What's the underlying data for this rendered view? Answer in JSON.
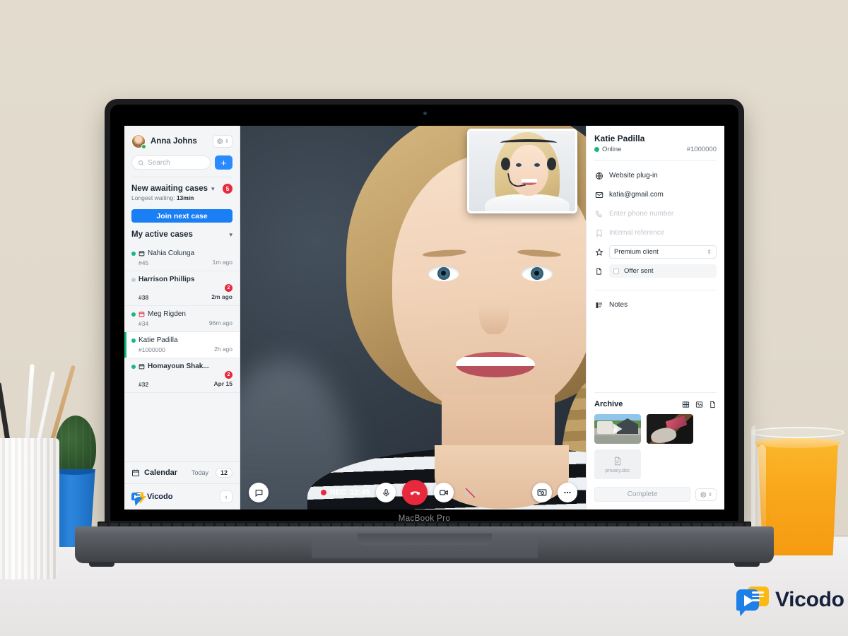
{
  "scene": {
    "device_label": "MacBook Pro",
    "brand": {
      "name": "Vicodo",
      "blue": "#1f7fe8",
      "yellow": "#fdb913",
      "text_color": "#16213c"
    }
  },
  "sidebar": {
    "user": {
      "name": "Anna Johns",
      "status": "online"
    },
    "settings_button_icon": "gear-icon",
    "search": {
      "placeholder": "Search",
      "value": ""
    },
    "add_button_label": "+",
    "awaiting": {
      "title": "New awaiting cases",
      "count": "5",
      "longest_label": "Longest waiting:",
      "longest_value": "13min",
      "join_button": "Join next case"
    },
    "active_section_title": "My active cases",
    "cases": [
      {
        "name": "Nahia Colunga",
        "id": "#45",
        "time": "1m ago",
        "presence": "#13b981",
        "icon": "calendar-icon",
        "unread": "",
        "bold": false,
        "active": false
      },
      {
        "name": "Harrison Phillips",
        "id": "#38",
        "time": "2m ago",
        "presence": "#c7ccd2",
        "icon": "",
        "unread": "2",
        "bold": true,
        "active": false
      },
      {
        "name": "Meg Rigden",
        "id": "#34",
        "time": "96m ago",
        "presence": "#13b981",
        "icon": "calendar-alert-icon",
        "unread": "",
        "bold": false,
        "active": false
      },
      {
        "name": "Katie Padilla",
        "id": "#1000000",
        "time": "2h ago",
        "presence": "#13b981",
        "icon": "",
        "unread": "",
        "bold": false,
        "active": true
      },
      {
        "name": "Homayoun Shak...",
        "id": "#32",
        "time": "Apr 15",
        "presence": "#13b981",
        "icon": "calendar-icon",
        "unread": "2",
        "bold": true,
        "active": false
      }
    ],
    "calendar": {
      "label": "Calendar",
      "today_label": "Today",
      "count": "12",
      "icon": "calendar-icon"
    },
    "footer": {
      "brand": "Vicodo",
      "collapse_icon": "chevron-left-icon"
    }
  },
  "call": {
    "recording_label": "REC",
    "timer": "12:45",
    "controls": [
      {
        "name": "chat-button",
        "icon": "chat-bubble-icon"
      },
      {
        "name": "microphone-button",
        "icon": "microphone-icon"
      },
      {
        "name": "end-call-button",
        "icon": "hangup-icon"
      },
      {
        "name": "camera-button",
        "icon": "video-camera-icon"
      },
      {
        "name": "screen-share-button",
        "icon": "screen-share-off-icon"
      },
      {
        "name": "snapshot-button",
        "icon": "snapshot-icon"
      },
      {
        "name": "more-options-button",
        "icon": "ellipsis-icon"
      }
    ],
    "self_view": {
      "label": "self-view",
      "presence": "agent with headset"
    }
  },
  "panel": {
    "client_name": "Katie Padilla",
    "status": "Online",
    "client_id": "#1000000",
    "fields": [
      {
        "icon": "globe-icon",
        "value": "Website plug-in",
        "placeholder": false
      },
      {
        "icon": "envelope-icon",
        "value": "katia@gmail.com",
        "placeholder": false
      },
      {
        "icon": "phone-icon",
        "value": "Enter phone number",
        "placeholder": true
      },
      {
        "icon": "bookmark-icon",
        "value": "Internal reference",
        "placeholder": true
      }
    ],
    "select_field": {
      "icon": "star-icon",
      "value": "Premium client"
    },
    "check_field": {
      "icon": "document-icon",
      "label": "Offer sent",
      "checked": false
    },
    "notes": {
      "icon": "notes-icon",
      "label": "Notes"
    },
    "archive": {
      "title": "Archive",
      "icons": [
        "film-icon",
        "image-icon",
        "document-icon"
      ],
      "items": [
        {
          "type": "video",
          "label": "house-video"
        },
        {
          "type": "image",
          "label": "desk-photo"
        },
        {
          "type": "file",
          "label": "privacy.doc"
        }
      ]
    },
    "footer": {
      "complete_label": "Complete",
      "settings_icon": "gear-icon"
    }
  }
}
